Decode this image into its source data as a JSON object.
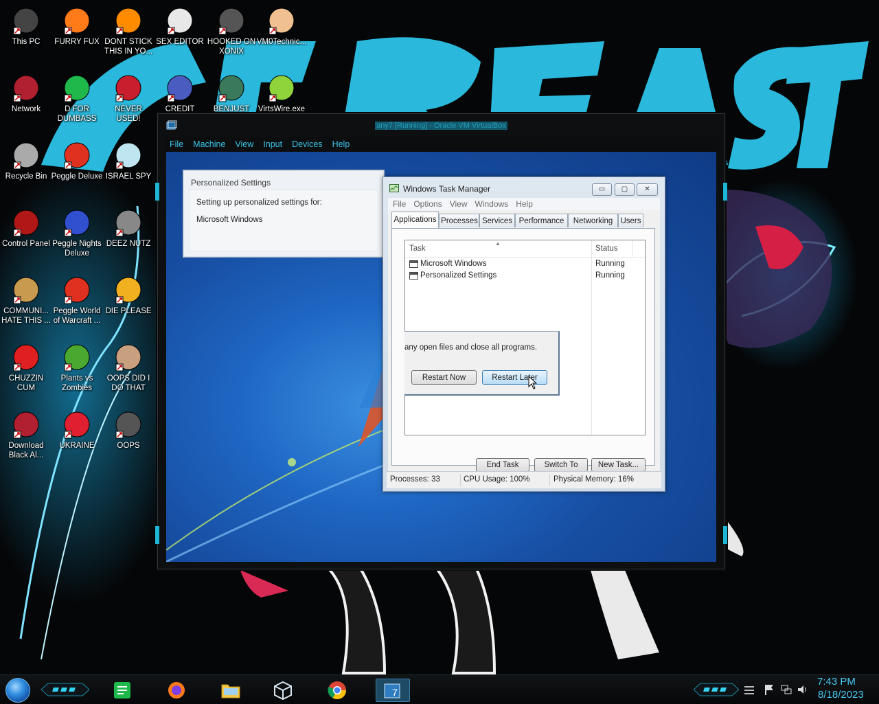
{
  "desktop": {
    "icons": [
      {
        "label": "This PC",
        "icon": "computer-icon"
      },
      {
        "label": "FURRY FUX",
        "icon": "firefox-icon"
      },
      {
        "label": "DONT STICK THIS IN YO...",
        "icon": "vlc-icon"
      },
      {
        "label": "SEX EDITOR",
        "icon": "editor-icon"
      },
      {
        "label": "HOOKED ON XONIX",
        "icon": "game-icon"
      },
      {
        "label": "VM0Technic...",
        "icon": "doctor-icon"
      },
      {
        "label": "Network",
        "icon": "network-icon"
      },
      {
        "label": "D FOR DUMBASS",
        "icon": "document-icon"
      },
      {
        "label": "NEVER USED!",
        "icon": "dev-cpp-icon"
      },
      {
        "label": "CREDIT CARD",
        "icon": "credit-card-icon"
      },
      {
        "label": "BENJUST LIKE",
        "icon": "santa-icon"
      },
      {
        "label": "VirtsWire.exe",
        "icon": "lime-icon"
      },
      {
        "label": "Recycle Bin",
        "icon": "recycle-bin-icon"
      },
      {
        "label": "Peggle Deluxe",
        "icon": "peggle-icon"
      },
      {
        "label": "ISRAEL SPY",
        "icon": "spy-icon"
      },
      {
        "label": "Control Panel",
        "icon": "control-panel-icon"
      },
      {
        "label": "Peggle Nights Deluxe",
        "icon": "peggle-nights-icon"
      },
      {
        "label": "DEEZ NUTZ",
        "icon": "stack-icon"
      },
      {
        "label": "COMMUNI... HATE THIS ...",
        "icon": "money-bag-icon"
      },
      {
        "label": "Peggle World of Warcraft ...",
        "icon": "peggle-wow-icon"
      },
      {
        "label": "DIE PLEASE",
        "icon": "de-icon"
      },
      {
        "label": "CHUZZIN CUM",
        "icon": "chuzzle-icon"
      },
      {
        "label": "Plants vs Zombies",
        "icon": "plants-icon"
      },
      {
        "label": "OOPS DID I DO THAT",
        "icon": "portrait-icon"
      },
      {
        "label": "Download Black Al...",
        "icon": "network-icon"
      },
      {
        "label": "UKRAINE",
        "icon": "radiation-icon"
      },
      {
        "label": "OOPS",
        "icon": "shortcut-icon"
      }
    ]
  },
  "vbox": {
    "title": "any7 [Running] - Oracle VM VirtualBox",
    "menu": [
      "File",
      "Machine",
      "View",
      "Input",
      "Devices",
      "Help"
    ]
  },
  "personalized": {
    "title": "Personalized Settings",
    "line1": "Setting up personalized settings for:",
    "line2": "Microsoft Windows"
  },
  "taskmgr": {
    "title": "Windows Task Manager",
    "controls": {
      "min": "▭",
      "max": "▢",
      "close": "✕"
    },
    "menu": [
      "File",
      "Options",
      "View",
      "Windows",
      "Help"
    ],
    "tabs": [
      "Applications",
      "Processes",
      "Services",
      "Performance",
      "Networking",
      "Users"
    ],
    "columns": {
      "task": "Task",
      "status": "Status"
    },
    "rows": [
      {
        "task": "Microsoft Windows",
        "status": "Running"
      },
      {
        "task": "Personalized Settings",
        "status": "Running"
      }
    ],
    "buttons": {
      "end": "End Task",
      "switch": "Switch To",
      "new": "New Task..."
    },
    "status": {
      "processes": "Processes: 33",
      "cpu": "CPU Usage: 100%",
      "memory": "Physical Memory: 16%"
    }
  },
  "restart": {
    "message": "any open files and close all programs.",
    "now": "Restart Now",
    "later": "Restart Later"
  },
  "clock": {
    "time": "7:43 PM",
    "date": "8/18/2023"
  },
  "colors": {
    "accent": "#2ab9dc",
    "win7_blue": "#1f67c4"
  }
}
